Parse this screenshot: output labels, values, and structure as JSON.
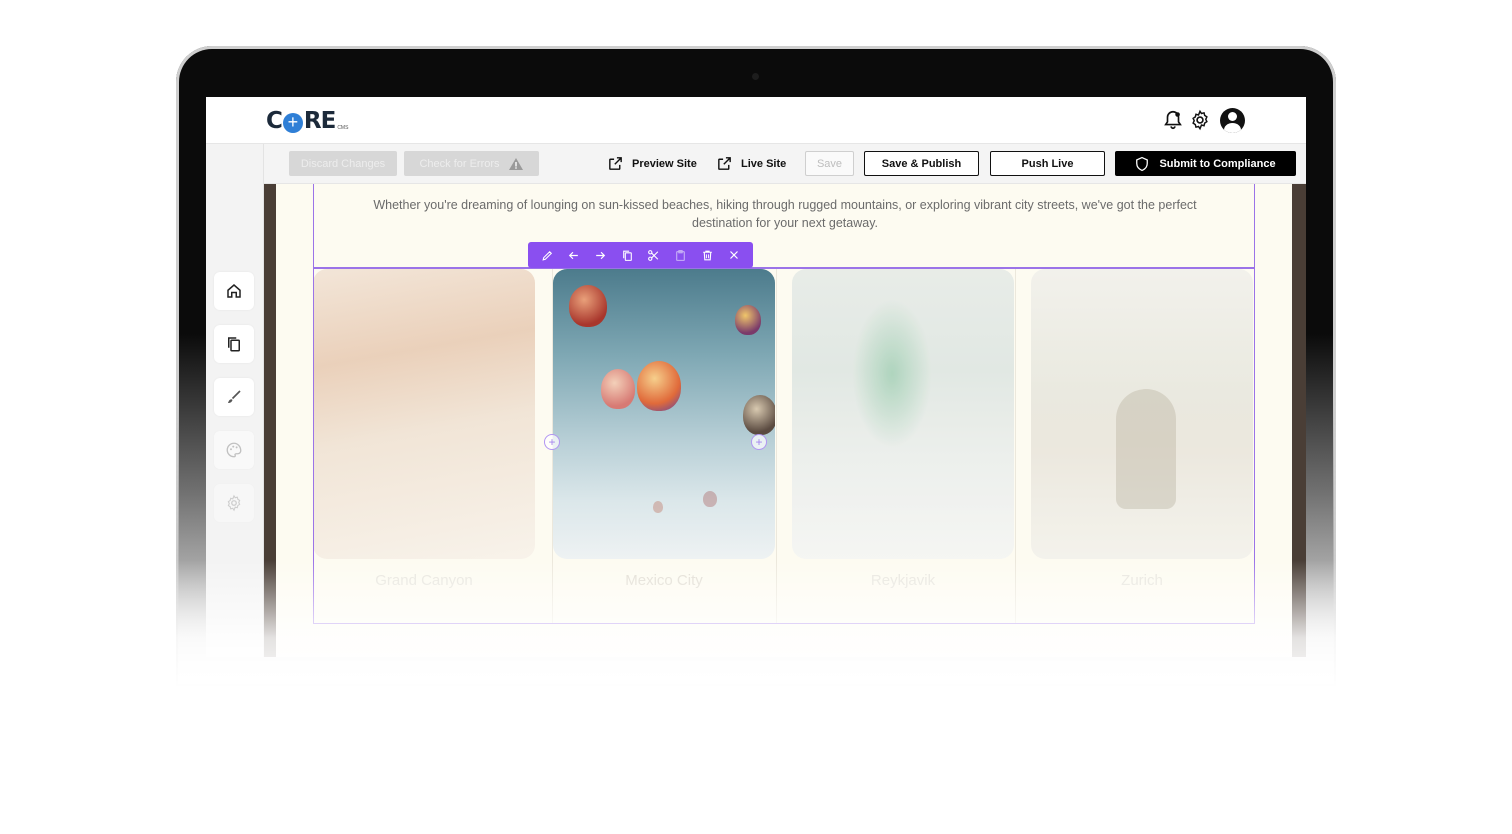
{
  "brand": {
    "logo_left": "C",
    "logo_right": "RE",
    "logo_sub": "CMS"
  },
  "header_icons": [
    "bell-icon",
    "gear-icon",
    "user-avatar-icon"
  ],
  "toolbar": {
    "discard_label": "Discard Changes",
    "check_errors_label": "Check for Errors",
    "preview_label": "Preview Site",
    "live_site_label": "Live Site",
    "save_label": "Save",
    "save_publish_label": "Save & Publish",
    "push_live_label": "Push Live",
    "submit_label": "Submit to Compliance"
  },
  "sidebar": {
    "items": [
      "home-icon",
      "pages-icon",
      "brush-icon",
      "palette-icon",
      "settings-icon"
    ]
  },
  "content": {
    "intro_text": "Whether you're dreaming of lounging on sun-kissed beaches, hiking through rugged mountains, or exploring vibrant city streets, we've got the perfect destination for your next getaway.",
    "cards": [
      {
        "label": "Grand Canyon"
      },
      {
        "label": "Mexico City"
      },
      {
        "label": "Reykjavik"
      },
      {
        "label": "Zurich"
      }
    ]
  },
  "edit_toolbar": [
    "pencil-icon",
    "arrow-left-icon",
    "arrow-right-icon",
    "copy-icon",
    "scissors-icon",
    "paste-icon",
    "trash-icon",
    "close-icon"
  ],
  "colors": {
    "accent": "#8a4ff0",
    "black": "#000000"
  }
}
